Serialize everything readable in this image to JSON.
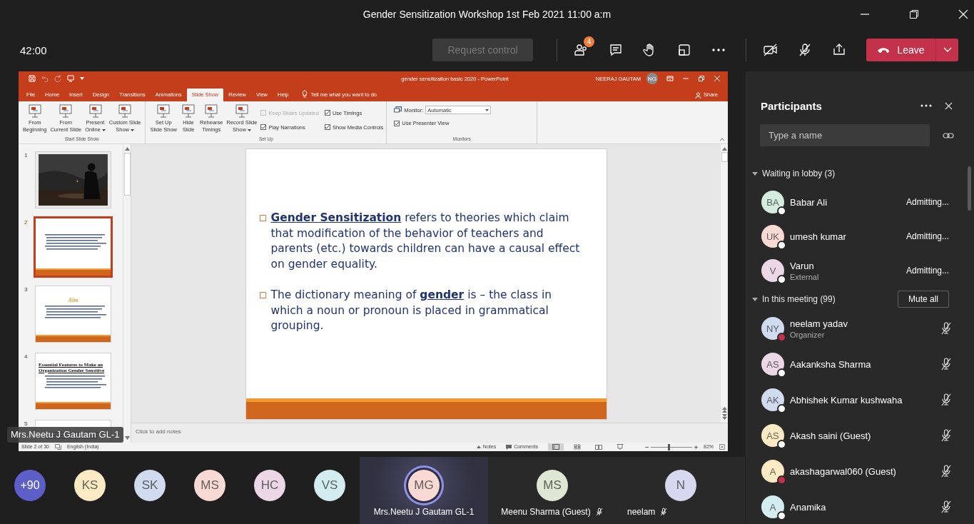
{
  "window": {
    "title": "Gender Sensitization Workshop 1st Feb 2021 11:00 a:m"
  },
  "call_bar": {
    "timer": "42:00",
    "request_control": {
      "label": "Request control",
      "disabled": true
    },
    "participants_badge": "4",
    "leave_label": "Leave"
  },
  "powerpoint": {
    "title": "gender sensitization basic 2020  -  PowerPoint",
    "user": "NEERAJ GAUTAM",
    "user_initials": "NG",
    "tabs": [
      {
        "label": "File",
        "selected": false
      },
      {
        "label": "Home",
        "selected": false
      },
      {
        "label": "Insert",
        "selected": false
      },
      {
        "label": "Design",
        "selected": false
      },
      {
        "label": "Transitions",
        "selected": false
      },
      {
        "label": "Animations",
        "selected": false
      },
      {
        "label": "Slide Show",
        "selected": true
      },
      {
        "label": "Review",
        "selected": false
      },
      {
        "label": "View",
        "selected": false
      },
      {
        "label": "Help",
        "selected": false
      }
    ],
    "tell_me": "Tell me what you want to do",
    "share": "Share",
    "ribbon_groups": [
      {
        "label": "Start Slide Show",
        "items": [
          {
            "kind": "button",
            "label": "From\nBeginning",
            "dropdown": false
          },
          {
            "kind": "button",
            "label": "From\nCurrent Slide",
            "dropdown": false
          },
          {
            "kind": "button",
            "label": "Present\nOnline",
            "dropdown": true
          },
          {
            "kind": "button",
            "label": "Custom Slide\nShow",
            "dropdown": true
          }
        ]
      },
      {
        "label": "Set Up",
        "items": [
          {
            "kind": "button",
            "label": "Set Up\nSlide Show",
            "dropdown": false
          },
          {
            "kind": "button",
            "label": "Hide\nSlide",
            "dropdown": false
          },
          {
            "kind": "button",
            "label": "Rehearse\nTimings",
            "dropdown": false
          },
          {
            "kind": "button",
            "label": "Record Slide\nShow",
            "dropdown": true
          },
          {
            "kind": "checkboxes",
            "options": [
              {
                "label": "Keep Slides Updated",
                "checked": false,
                "disabled": true
              },
              {
                "label": "Play Narrations",
                "checked": true,
                "disabled": false
              },
              {
                "label": "Use Timings",
                "checked": true,
                "disabled": false
              },
              {
                "label": "Show Media Controls",
                "checked": true,
                "disabled": false
              }
            ]
          }
        ]
      },
      {
        "label": "Monitors",
        "items": [
          {
            "kind": "monitor",
            "label": "Monitor:",
            "value": "Automatic",
            "presenter_view": {
              "label": "Use Presenter View",
              "checked": true
            }
          }
        ]
      }
    ],
    "thumbnails": [
      {
        "number": "1",
        "selected": false
      },
      {
        "number": "2",
        "kind": "text",
        "selected": true
      },
      {
        "number": "3",
        "kind": "text",
        "title": "Aim",
        "selected": false
      },
      {
        "number": "4",
        "kind": "text",
        "title": "Essential Features to Make an Organization Gender Sensitive",
        "selected": false
      },
      {
        "number": "5",
        "kind": "text_top",
        "selected": false
      }
    ],
    "slide": {
      "bullets": [
        "**Gender  Sensitization** refers to theories which claim that modification of the behavior of teachers and parents (etc.) towards children can have a causal effect on gender equality.",
        "The dictionary meaning of **gender** is – the class in which a noun or pronoun is placed in grammatical grouping."
      ]
    },
    "notes_placeholder": "Click to add notes",
    "status_bar": {
      "slide_position": "Slide 2 of 30",
      "language": "English (India)",
      "notes": "Notes",
      "comments": "Comments",
      "zoom": "82%",
      "zoom_slider": {
        "level": 0.42
      },
      "views": [
        {
          "selected": true
        },
        {
          "selected": false
        },
        {
          "selected": false
        },
        {
          "selected": false
        }
      ]
    }
  },
  "presenter_label": "Mrs.Neetu J Gautam GL-1",
  "participants_panel": {
    "title": "Participants",
    "search_placeholder": "Type a name",
    "sections": [
      {
        "title": "Waiting in lobby (3)",
        "expanded": true,
        "people": [
          {
            "initials": "BA",
            "name": "Babar Ali",
            "color": "#d4ecdf",
            "busy": false,
            "action": "Admitting..."
          },
          {
            "initials": "UK",
            "name": "umesh kumar",
            "color": "#f8d9d3",
            "busy": false,
            "action": "Admitting..."
          },
          {
            "initials": "V",
            "name": "Varun",
            "subtitle": "External",
            "color": "#ecd7e6",
            "busy": false,
            "action": "Admitting..."
          }
        ]
      },
      {
        "title": "In this meeting (99)",
        "expanded": true,
        "button": "Mute all",
        "people": [
          {
            "initials": "NY",
            "name": "neelam yadav",
            "subtitle": "Organizer",
            "color": "#d0dbf0",
            "busy": true,
            "muted": true
          },
          {
            "initials": "AS",
            "name": "Aakanksha Sharma",
            "color": "#ecd7e6",
            "busy": false,
            "muted": true
          },
          {
            "initials": "AK",
            "name": "Abhishek Kumar kushwaha",
            "color": "#d0dbf0",
            "busy": false,
            "muted": true
          },
          {
            "initials": "AS",
            "name": "Akash saini (Guest)",
            "color": "#fbeac3",
            "busy": false,
            "muted": true
          },
          {
            "initials": "A",
            "name": "akashagarwal060 (Guest)",
            "color": "#fbeac3",
            "busy": true,
            "muted": true
          },
          {
            "initials": "A",
            "name": "Anamika",
            "color": "#d3ecef",
            "busy": false,
            "muted": true
          }
        ]
      }
    ]
  },
  "gallery": {
    "overflow": "+90",
    "avatars": [
      {
        "initials": "KS",
        "color": "#fbeac3"
      },
      {
        "initials": "SK",
        "color": "#d0dbf0"
      },
      {
        "initials": "MS",
        "color": "#f8d9d3"
      },
      {
        "initials": "HC",
        "color": "#ecd7e6"
      },
      {
        "initials": "VS",
        "color": "#d3ecef"
      }
    ],
    "tiles": [
      {
        "initials": "MG",
        "name": "Mrs.Neetu J Gautam GL-1",
        "color": "#f8d9d3",
        "speaking": true,
        "muted": false
      },
      {
        "initials": "MS",
        "name": "Meenu Sharma (Guest)",
        "color": "#dde7d3",
        "speaking": false,
        "muted": true
      },
      {
        "initials": "N",
        "name": "neelam",
        "color": "#d6d8f0",
        "speaking": false,
        "muted": true
      }
    ]
  }
}
